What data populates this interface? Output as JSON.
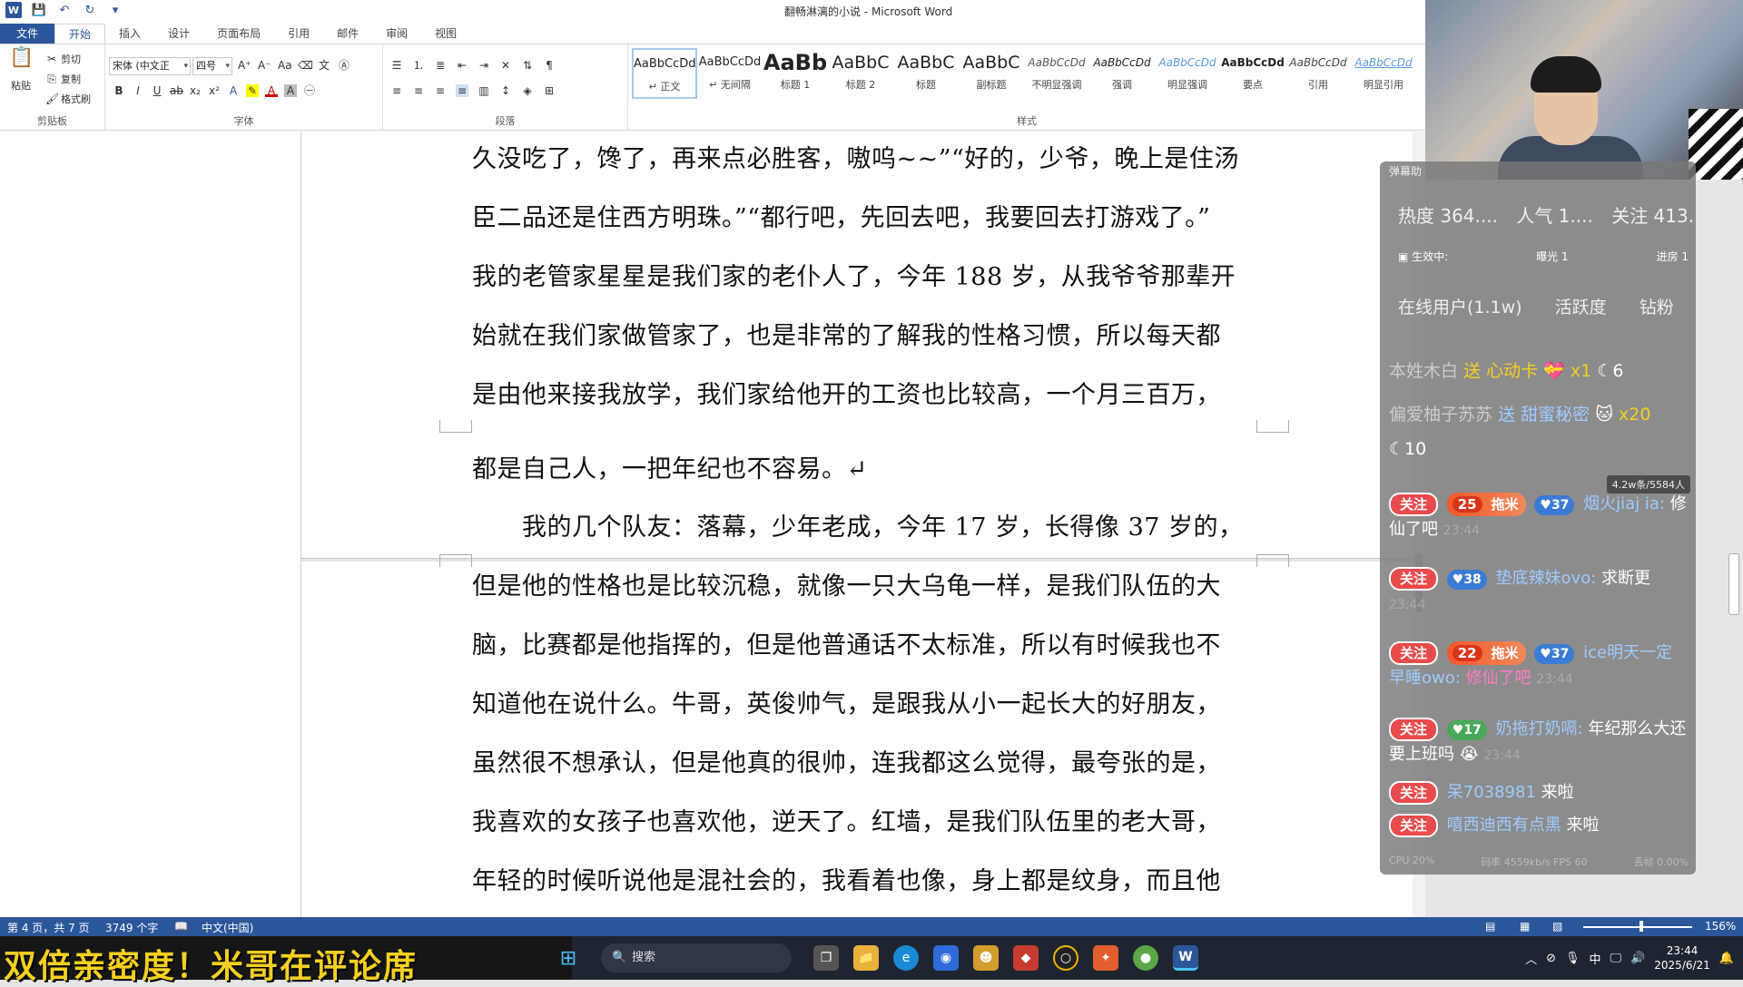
{
  "window": {
    "title": "翻畅淋漓的小说 - Microsoft Word"
  },
  "tabs": [
    "文件",
    "开始",
    "插入",
    "设计",
    "页面布局",
    "引用",
    "邮件",
    "审阅",
    "视图"
  ],
  "ribbon": {
    "clipboard": {
      "paste": "粘贴",
      "cut": "剪切",
      "copy": "复制",
      "format_painter": "格式刷",
      "label": "剪贴板"
    },
    "font": {
      "name": "宋体 (中文正",
      "size": "四号",
      "label": "字体"
    },
    "paragraph": {
      "label": "段落"
    },
    "styles_label": "样式",
    "styles": [
      {
        "preview": "AaBbCcDd",
        "name": "↵ 正文"
      },
      {
        "preview": "AaBbCcDd",
        "name": "↵ 无间隔"
      },
      {
        "preview": "AaBb",
        "name": "标题 1"
      },
      {
        "preview": "AaBbC",
        "name": "标题 2"
      },
      {
        "preview": "AaBbC",
        "name": "标题"
      },
      {
        "preview": "AaBbC",
        "name": "副标题"
      },
      {
        "preview": "AaBbCcDd",
        "name": "不明显强调"
      },
      {
        "preview": "AaBbCcDd",
        "name": "强调"
      },
      {
        "preview": "AaBbCcDd",
        "name": "明显强调"
      },
      {
        "preview": "AaBbCcDd",
        "name": "要点"
      },
      {
        "preview": "AaBbCcDd",
        "name": "引用"
      },
      {
        "preview": "AaBbCcDd",
        "name": "明显引用"
      }
    ]
  },
  "document": {
    "page1": [
      "久没吃了，馋了，再来点必胜客，嗷呜~~”“好的，少爷，晚上是住汤",
      "臣二品还是住西方明珠。”“都行吧，先回去吧，我要回去打游戏了。”",
      "我的老管家星星是我们家的老仆人了，今年 188 岁，从我爷爷那辈开",
      "始就在我们家做管家了，也是非常的了解我的性格习惯，所以每天都",
      "是由他来接我放学，我们家给他开的工资也比较高，一个月三百万，"
    ],
    "page2": [
      "都是自己人，一把年纪也不容易。↵",
      "　　我的几个队友：落幕，少年老成，今年 17 岁，长得像 37 岁的，",
      "但是他的性格也是比较沉稳，就像一只大乌龟一样，是我们队伍的大",
      "脑，比赛都是他指挥的，但是他普通话不太标准，所以有时候我也不",
      "知道他在说什么。牛哥，英俊帅气，是跟我从小一起长大的好朋友，",
      "虽然很不想承认，但是他真的很帅，连我都这么觉得，最夸张的是，",
      "我喜欢的女孩子也喜欢他，逆天了。红墙，是我们队伍里的老大哥，",
      "年轻的时候听说他是混社会的，我看着也像，身上都是纹身，而且他"
    ]
  },
  "status": {
    "page": "第 4 页，共 7 页",
    "words": "3749 个字",
    "lang": "中文(中国)",
    "zoom": "156%"
  },
  "banner": {
    "text": "双倍亲密度！米哥在评论席"
  },
  "taskbar": {
    "search": "搜索",
    "ime": "中",
    "time": "23:44",
    "date": "2025/6/21"
  },
  "chat": {
    "header": "弹幕助",
    "stats": [
      "热度 364....",
      "人气 1....",
      "关注 413...."
    ],
    "sub": [
      "生效中:",
      "曝光 1",
      "进房 1"
    ],
    "tabs": [
      "在线用户(1.1w)",
      "活跃度",
      "钻粉"
    ],
    "gift1": {
      "user": "本姓木白",
      "action": "送",
      "item": "心动卡",
      "count": "x1",
      "score": "6"
    },
    "gift2": {
      "user": "偏爱柚子苏苏",
      "action": "送",
      "item": "甜蜜秘密",
      "count": "x20",
      "score": "10"
    },
    "badge": "4.2w条/5584人",
    "follow": "关注",
    "msgs": [
      {
        "level": "25",
        "title": "拖米",
        "fans": "37",
        "user": "烟火jiaj ia:",
        "text": "修仙了吧",
        "time": "23:44"
      },
      {
        "fans": "38",
        "user": "垫底辣妹ovo:",
        "text": "求断更",
        "time": "23:44"
      },
      {
        "level": "22",
        "title": "拖米",
        "fans": "37",
        "user": "ice明天一定早睡owo:",
        "text": "修仙了吧",
        "time": "23:44"
      },
      {
        "fans": "17",
        "user": "奶拖打奶嗝:",
        "text": "年纪那么大还要上班吗",
        "time": "23:44"
      },
      {
        "user": "呆7038981",
        "text": "来啦"
      },
      {
        "user": "嘻西迪西有点黑",
        "text": "来啦"
      }
    ],
    "footer": [
      "CPU 20%",
      "码率 4559kb/s FPS 60",
      "丢帧 0.00%"
    ]
  }
}
